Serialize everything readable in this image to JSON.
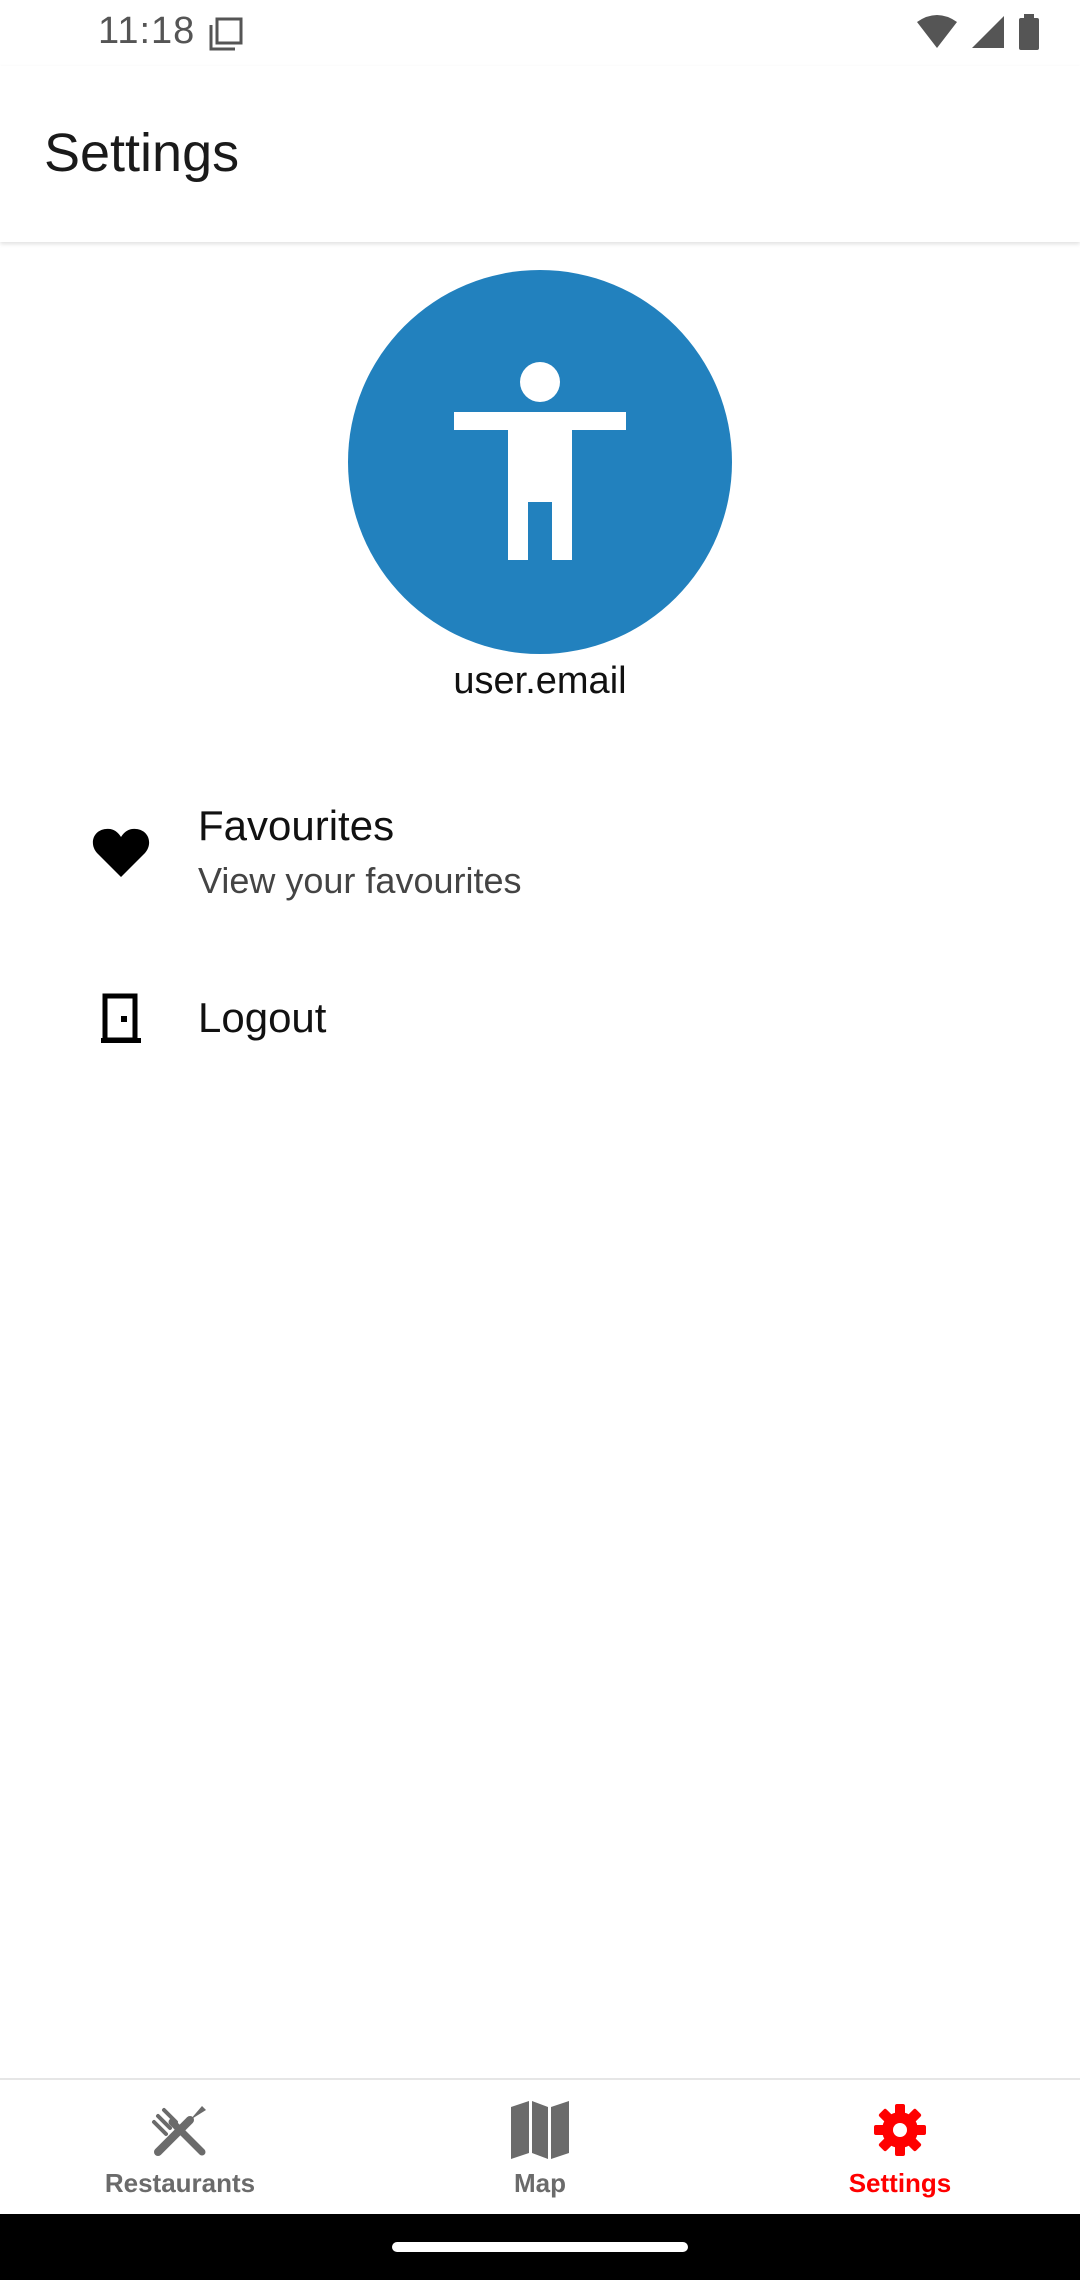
{
  "status_bar": {
    "time": "11:18",
    "icons": [
      "screenshot-icon",
      "wifi-icon",
      "signal-icon",
      "battery-icon"
    ]
  },
  "app_bar": {
    "title": "Settings"
  },
  "profile": {
    "avatar_icon": "accessibility-person-icon",
    "avatar_color": "#2281be",
    "email": "user.email"
  },
  "list": {
    "favourites": {
      "icon": "heart-icon",
      "title": "Favourites",
      "subtitle": "View your favourites"
    },
    "logout": {
      "icon": "door-icon",
      "title": "Logout"
    }
  },
  "bottom_nav": {
    "tabs": [
      {
        "icon": "fork-knife-icon",
        "label": "Restaurants",
        "active": false
      },
      {
        "icon": "map-icon",
        "label": "Map",
        "active": false
      },
      {
        "icon": "gear-icon",
        "label": "Settings",
        "active": true
      }
    ],
    "active_color": "#ff0000",
    "inactive_color": "#6b6b6b"
  }
}
